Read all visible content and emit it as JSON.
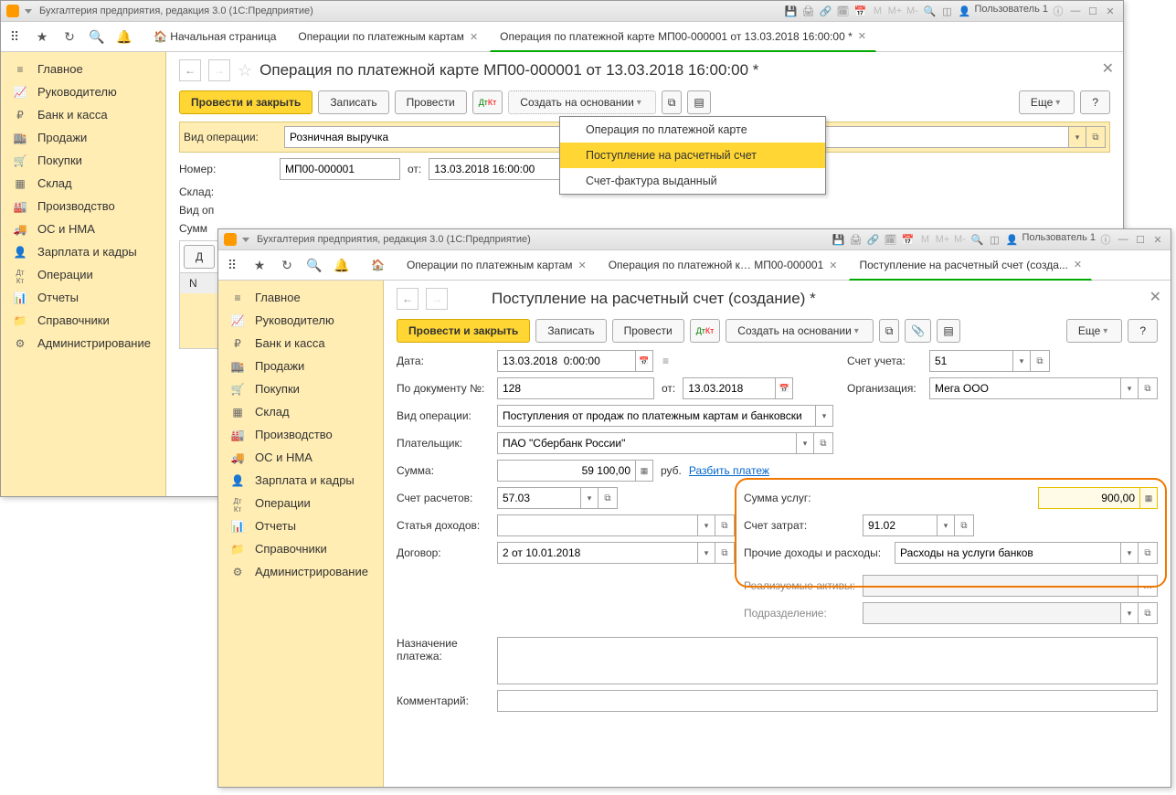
{
  "app_title": "Бухгалтерия предприятия, редакция 3.0  (1С:Предприятие)",
  "user_label": "Пользователь 1",
  "sidebar": [
    {
      "icon": "≡",
      "label": "Главное"
    },
    {
      "icon": "📈",
      "label": "Руководителю"
    },
    {
      "icon": "₽",
      "label": "Банк и касса"
    },
    {
      "icon": "🏬",
      "label": "Продажи"
    },
    {
      "icon": "🛒",
      "label": "Покупки"
    },
    {
      "icon": "▦",
      "label": "Склад"
    },
    {
      "icon": "🏭",
      "label": "Производство"
    },
    {
      "icon": "🚚",
      "label": "ОС и НМА"
    },
    {
      "icon": "👤",
      "label": "Зарплата и кадры"
    },
    {
      "icon": "Дт Кт",
      "label": "Операции"
    },
    {
      "icon": "📊",
      "label": "Отчеты"
    },
    {
      "icon": "📁",
      "label": "Справочники"
    },
    {
      "icon": "⚙",
      "label": "Администрирование"
    }
  ],
  "win1": {
    "tabs": {
      "home": "Начальная страница",
      "t1": "Операции по платежным картам",
      "t2": "Операция по платежной карте МП00-000001 от 13.03.2018 16:00:00 *"
    },
    "title": "Операция по платежной карте МП00-000001 от 13.03.2018 16:00:00 *",
    "buttons": {
      "post_close": "Провести и закрыть",
      "record": "Записать",
      "post": "Провести",
      "create_on": "Создать на основании",
      "more": "Еще",
      "help": "?"
    },
    "dropdown": {
      "i1": "Операция по платежной карте",
      "i2": "Поступление на расчетный счет",
      "i3": "Счет-фактура выданный"
    },
    "labels": {
      "op_type": "Вид операции:",
      "number": "Номер:",
      "from": "от:",
      "warehouse": "Склад:",
      "op_view": "Вид оп",
      "sum": "Сумм",
      "col_n": "N"
    },
    "values": {
      "op_type": "Розничная выручка",
      "number": "МП00-000001",
      "date": "13.03.2018 16:00:00",
      "col_d": "Д"
    }
  },
  "win2": {
    "tabs": {
      "t1": "Операции по платежным картам",
      "t2": "Операция по платежной к… МП00-000001",
      "t3": "Поступление на расчетный счет (созда..."
    },
    "title": "Поступление на расчетный счет (создание) *",
    "buttons": {
      "post_close": "Провести и закрыть",
      "record": "Записать",
      "post": "Провести",
      "create_on": "Создать на основании",
      "more": "Еще",
      "help": "?"
    },
    "labels": {
      "date": "Дата:",
      "doc_no": "По документу №:",
      "from": "от:",
      "op_type": "Вид операции:",
      "payer": "Плательщик:",
      "sum": "Сумма:",
      "rub": "руб.",
      "split": "Разбить платеж",
      "acc_calc": "Счет расчетов:",
      "income_item": "Статья доходов:",
      "contract": "Договор:",
      "acc": "Счет учета:",
      "org": "Организация:",
      "svc_sum": "Сумма услуг:",
      "cost_acc": "Счет затрат:",
      "other": "Прочие доходы и расходы:",
      "assets": "Реализуемые активы:",
      "division": "Подразделение:",
      "purpose": "Назначение платежа:",
      "comment": "Комментарий:"
    },
    "values": {
      "date": "13.03.2018  0:00:00",
      "doc_no": "128",
      "doc_date": "13.03.2018",
      "op_type": "Поступления от продаж по платежным картам и банковски",
      "payer": "ПАО \"Сбербанк России\"",
      "sum": "59 100,00",
      "acc_calc": "57.03",
      "contract": "2 от 10.01.2018",
      "acc": "51",
      "org": "Мега ООО",
      "svc_sum": "900,00",
      "cost_acc": "91.02",
      "other": "Расходы на услуги банков"
    }
  }
}
